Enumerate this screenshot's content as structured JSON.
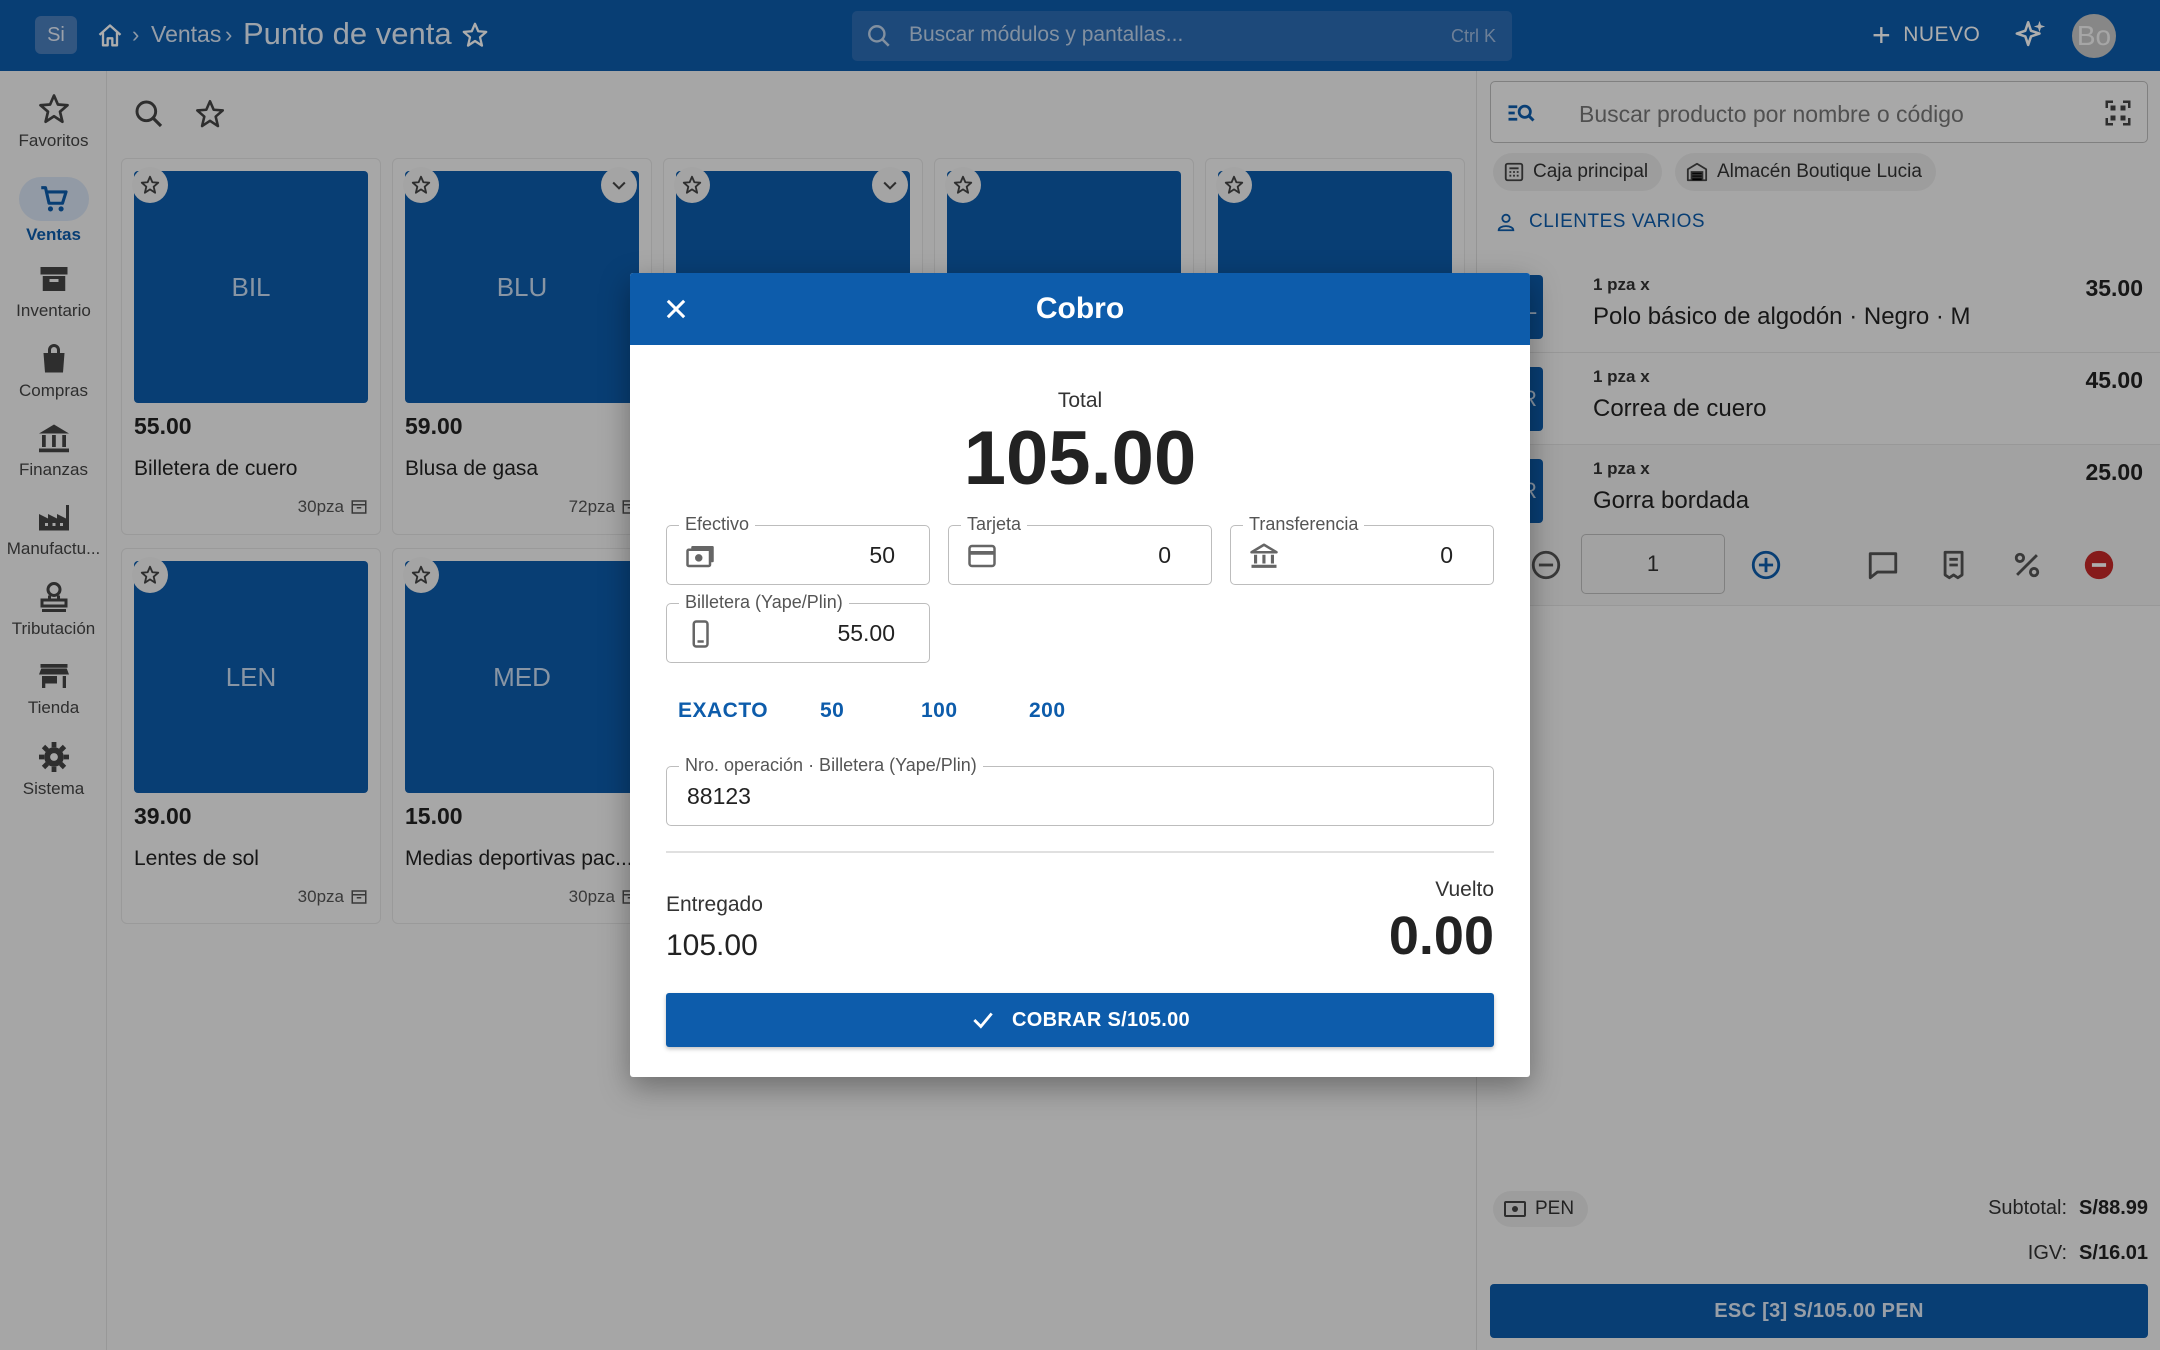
{
  "topbar": {
    "app_badge": "Si",
    "breadcrumb": "Ventas",
    "page_title": "Punto de venta",
    "search_placeholder": "Buscar módulos y pantallas...",
    "search_shortcut": "Ctrl K",
    "nuevo_label": "NUEVO",
    "avatar_initials": "Bo"
  },
  "nav": [
    {
      "label": "Favoritos",
      "icon": "star-icon"
    },
    {
      "label": "Ventas",
      "icon": "cart-icon",
      "active": true
    },
    {
      "label": "Inventario",
      "icon": "archive-icon"
    },
    {
      "label": "Compras",
      "icon": "bag-icon"
    },
    {
      "label": "Finanzas",
      "icon": "bank-icon"
    },
    {
      "label": "Manufactu...",
      "icon": "factory-icon"
    },
    {
      "label": "Tributación",
      "icon": "stamp-icon"
    },
    {
      "label": "Tienda",
      "icon": "store-icon"
    },
    {
      "label": "Sistema",
      "icon": "gear-icon"
    }
  ],
  "products": [
    {
      "code": "BIL",
      "price": "55.00",
      "name": "Billetera de cuero",
      "stock": "30pza"
    },
    {
      "code": "BLU",
      "price": "59.00",
      "name": "Blusa de gasa",
      "stock": "72pza"
    },
    {
      "code": "",
      "price": "",
      "name": "",
      "stock": ""
    },
    {
      "code": "",
      "price": "",
      "name": "",
      "stock": ""
    },
    {
      "code": "",
      "price": "",
      "name": "",
      "stock": ""
    },
    {
      "code": "LEN",
      "price": "39.00",
      "name": "Lentes de sol",
      "stock": "30pza"
    },
    {
      "code": "MED",
      "price": "15.00",
      "name": "Medias deportivas pac...",
      "stock": "30pza"
    }
  ],
  "panel": {
    "search_placeholder": "Buscar producto por nombre o código",
    "chip_caja": "Caja principal",
    "chip_almacen": "Almacén Boutique Lucia",
    "cliente": "CLIENTES VARIOS",
    "cart": [
      {
        "thumb": "POL",
        "qty": "1 pza x",
        "name": "Polo básico de algodón · Negro · M",
        "price": "35.00"
      },
      {
        "thumb": "COR",
        "qty": "1 pza x",
        "name": "Correa de cuero",
        "price": "45.00"
      },
      {
        "thumb": "GOR",
        "qty": "1 pza x",
        "name": "Gorra bordada",
        "price": "25.00"
      }
    ],
    "selected_qty": "1",
    "currency": "PEN",
    "subtotal_label": "Subtotal:",
    "subtotal_value": "S/88.99",
    "igv_label": "IGV:",
    "igv_value": "S/16.01",
    "charge_bar": "ESC [3] S/105.00 PEN"
  },
  "dialog": {
    "title": "Cobro",
    "total_label": "Total",
    "total_value": "105.00",
    "fields": {
      "efectivo": {
        "label": "Efectivo",
        "value": "50"
      },
      "tarjeta": {
        "label": "Tarjeta",
        "value": "0"
      },
      "transferencia": {
        "label": "Transferencia",
        "value": "0"
      },
      "billetera": {
        "label": "Billetera (Yape/Plin)",
        "value": "55.00"
      }
    },
    "quick": [
      "EXACTO",
      "50",
      "100",
      "200"
    ],
    "operation": {
      "label": "Nro. operación · Billetera (Yape/Plin)",
      "value": "88123"
    },
    "entregado_label": "Entregado",
    "entregado_value": "105.00",
    "vuelto_label": "Vuelto",
    "vuelto_value": "0.00",
    "cobrar_label": "COBRAR S/105.00"
  },
  "colors": {
    "brand": "#0d5cab",
    "danger": "#c62828"
  }
}
